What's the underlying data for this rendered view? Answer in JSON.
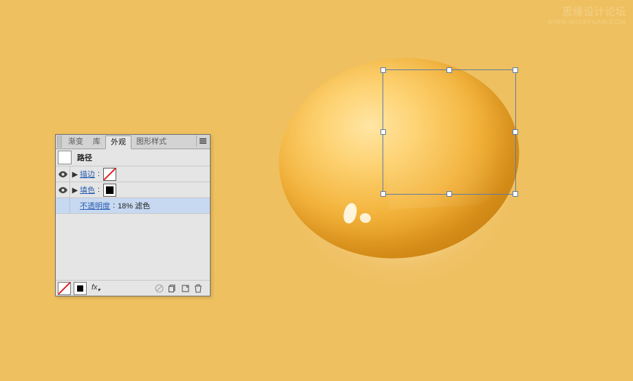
{
  "watermark": {
    "line1": "思缘设计论坛",
    "line2": "WWW.MISSYUAN.COM"
  },
  "panel": {
    "tabs": {
      "gradient": "渐变",
      "library": "库",
      "appearance": "外观",
      "graphic_styles": "图形样式"
    },
    "object_label": "路径",
    "stroke": {
      "label": "描边",
      "separator": ":"
    },
    "fill": {
      "label": "填色",
      "separator": ":"
    },
    "opacity_row": {
      "label": "不透明度",
      "separator": ":",
      "value": "18% 滤色"
    },
    "footer": {
      "fx_label": "fx"
    }
  }
}
